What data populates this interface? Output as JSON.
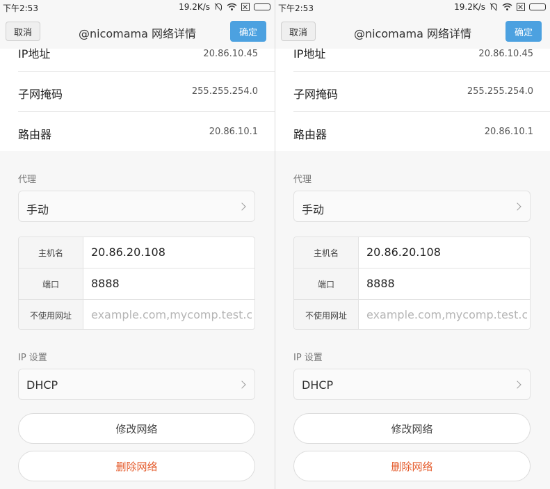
{
  "status": {
    "time": "下午2:53",
    "speed": "19.2K/s"
  },
  "header": {
    "cancel": "取消",
    "title": "@nicomama  网络详情",
    "ok": "确定"
  },
  "info": {
    "ip_label": "IP地址",
    "ip_value": "20.86.10.45",
    "mask_label": "子网掩码",
    "mask_value": "255.255.254.0",
    "router_label": "路由器",
    "router_value": "20.86.10.1"
  },
  "proxy": {
    "section_label": "代理",
    "mode": "手动",
    "host_label": "主机名",
    "host_value": "20.86.20.108",
    "port_label": "端口",
    "port_value": "8888",
    "bypass_label": "不使用网址",
    "bypass_placeholder": "example.com,mycomp.test.c..."
  },
  "ip_settings": {
    "section_label": "IP 设置",
    "mode": "DHCP"
  },
  "actions": {
    "modify": "修改网络",
    "delete": "删除网络"
  },
  "colors": {
    "accent": "#4ca1e0",
    "danger": "#e45a2a"
  }
}
